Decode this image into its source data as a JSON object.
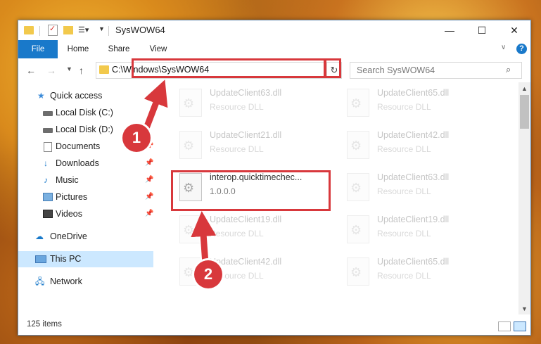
{
  "window": {
    "title": "SysWOW64",
    "controls": {
      "minimize": "—",
      "maximize": "☐",
      "close": "✕"
    }
  },
  "ribbon": {
    "tabs": [
      "File",
      "Home",
      "Share",
      "View"
    ]
  },
  "navigation": {
    "address": "C:\\Windows\\SysWOW64",
    "search_placeholder": "Search SysWOW64"
  },
  "sidebar": {
    "items": [
      {
        "label": "Quick access",
        "icon": "star-icon",
        "pinned": false
      },
      {
        "label": "Local Disk (C:)",
        "icon": "disk-icon",
        "pinned": false
      },
      {
        "label": "Local Disk (D:)",
        "icon": "disk-icon",
        "pinned": false
      },
      {
        "label": "Documents",
        "icon": "documents-icon",
        "pinned": true
      },
      {
        "label": "Downloads",
        "icon": "download-icon",
        "pinned": true
      },
      {
        "label": "Music",
        "icon": "music-icon",
        "pinned": true
      },
      {
        "label": "Pictures",
        "icon": "pictures-icon",
        "pinned": true
      },
      {
        "label": "Videos",
        "icon": "videos-icon",
        "pinned": true
      },
      {
        "label": "OneDrive",
        "icon": "cloud-icon",
        "pinned": false
      },
      {
        "label": "This PC",
        "icon": "computer-icon",
        "pinned": false,
        "selected": true
      },
      {
        "label": "Network",
        "icon": "network-icon",
        "pinned": false
      }
    ]
  },
  "files": [
    {
      "name": "UpdateClient63.dll",
      "type": "Resource DLL",
      "faded": true
    },
    {
      "name": "UpdateClient65.dll",
      "type": "Resource DLL",
      "faded": true
    },
    {
      "name": "UpdateClient21.dll",
      "type": "Resource DLL",
      "faded": true
    },
    {
      "name": "UpdateClient42.dll",
      "type": "Resource DLL",
      "faded": true
    },
    {
      "name": "interop.quicktimechec...",
      "type": "1.0.0.0",
      "faded": false
    },
    {
      "name": "UpdateClient63.dll",
      "type": "Resource DLL",
      "faded": true
    },
    {
      "name": "UpdateClient19.dll",
      "type": "Resource DLL",
      "faded": true
    },
    {
      "name": "UpdateClient19.dll",
      "type": "Resource DLL",
      "faded": true
    },
    {
      "name": "UpdateClient42.dll",
      "type": "Resource DLL",
      "faded": true
    },
    {
      "name": "UpdateClient65.dll",
      "type": "Resource DLL",
      "faded": true
    }
  ],
  "status": {
    "item_count": "125 items"
  },
  "callouts": [
    "1",
    "2"
  ],
  "colors": {
    "accent": "#1979ca",
    "highlight": "#d8383c",
    "selection": "#cce8ff"
  }
}
